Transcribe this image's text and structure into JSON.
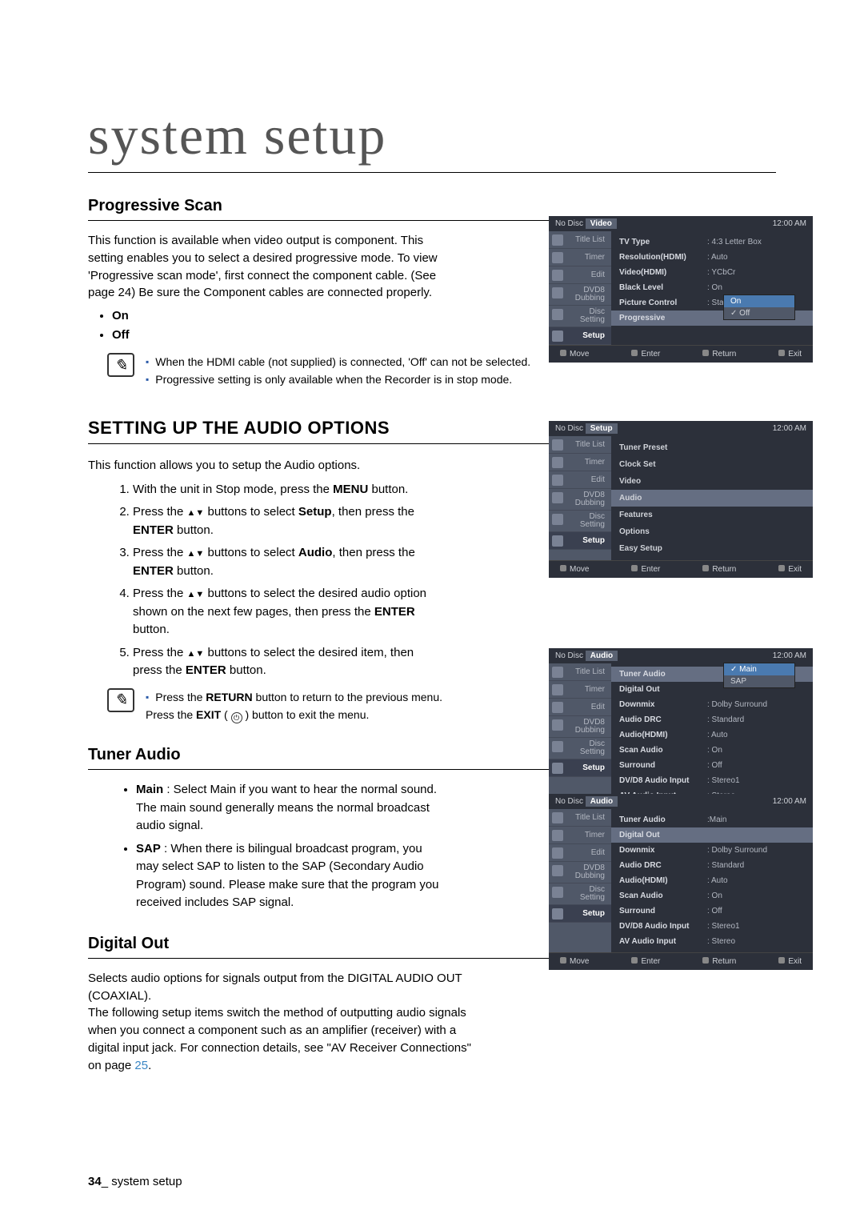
{
  "page_title": "system setup",
  "sec_prog": {
    "h": "Progressive Scan",
    "p": "This function is available when video output is component. This setting enables you to select a desired progressive mode. To view 'Progressive scan mode', first connect the component cable. (See page 24) Be sure the Component cables are connected properly.",
    "b1": "On",
    "b2": "Off",
    "n1": "When the HDMI cable (not supplied) is connected, 'Off' can not be selected.",
    "n2": "Progressive setting is only available when the Recorder is in stop mode."
  },
  "sec_audio": {
    "h": "SETTING UP THE AUDIO OPTIONS",
    "p": "This function allows you to setup the Audio options.",
    "s1a": "With the unit in Stop mode, press the ",
    "s1b": "MENU",
    "s1c": " button.",
    "s2a": "Press the ",
    "s2b": "▲▼",
    "s2c": " buttons to select ",
    "s2d": "Setup",
    "s2e": ", then press the ",
    "s2f": "ENTER",
    "s2g": " button.",
    "s3a": "Press the ",
    "s3b": "▲▼",
    "s3c": " buttons to select ",
    "s3d": "Audio",
    "s3e": ", then press the ",
    "s3f": "ENTER",
    "s3g": " button.",
    "s4a": "Press the ",
    "s4b": "▲▼",
    "s4c": " buttons to select the desired audio option shown on the next few pages, then press the ",
    "s4d": "ENTER",
    "s4e": " button.",
    "s5a": "Press the ",
    "s5b": "▲▼",
    "s5c": " buttons to select the desired item, then press the ",
    "s5d": "ENTER",
    "s5e": " button.",
    "n1a": "Press the ",
    "n1b": "RETURN",
    "n1c": " button to return to the previous menu.",
    "n2a": "Press the ",
    "n2b": "EXIT",
    "n2c": " ( ",
    "n2d": " ) button to exit the menu."
  },
  "sec_tuner": {
    "h": "Tuner Audio",
    "b1t": "Main",
    "b1d": " : Select Main if you want to hear the normal sound. The main sound generally means the normal broadcast audio signal.",
    "b2t": "SAP",
    "b2d": " : When there is bilingual broadcast program, you may select SAP to listen to the SAP (Secondary Audio Program) sound. Please make sure that the program you received includes SAP signal."
  },
  "sec_dout": {
    "h": "Digital Out",
    "p1": "Selects audio options for signals output from the DIGITAL AUDIO OUT (COAXIAL).",
    "p2a": "The following setup items switch the method of outputting audio signals when you connect a component such as an amplifier (receiver) with a digital input jack. For connection details, see \"AV Receiver Connections\" on page ",
    "p2b": "25",
    "p2c": "."
  },
  "footer": {
    "num": "34",
    "sep": "_",
    "txt": " system setup"
  },
  "osd_common": {
    "no_disc": "No Disc",
    "time": "12:00 AM",
    "side": [
      "Title List",
      "Timer",
      "Edit",
      "DVD8\nDubbing",
      "Disc\nSetting",
      "Setup"
    ],
    "bot": [
      "Move",
      "Enter",
      "Return",
      "Exit"
    ]
  },
  "osd1": {
    "crumb": "Video",
    "rows": [
      {
        "k": "TV Type",
        "v": ": 4:3 Letter Box"
      },
      {
        "k": "Resolution(HDMI)",
        "v": ": Auto"
      },
      {
        "k": "Video(HDMI)",
        "v": ": YCbCr"
      },
      {
        "k": "Black Level",
        "v": ": On"
      },
      {
        "k": "Picture Control",
        "v": ": Standard"
      },
      {
        "k": "Progressive",
        "v": ""
      }
    ],
    "drop": [
      "On",
      "Off"
    ]
  },
  "osd2": {
    "crumb": "Setup",
    "rows": [
      "Tuner Preset",
      "Clock Set",
      "Video",
      "Audio",
      "Features",
      "Options",
      "Easy Setup"
    ]
  },
  "osd3": {
    "crumb": "Audio",
    "rows": [
      {
        "k": "Tuner Audio",
        "v": ""
      },
      {
        "k": "Digital Out",
        "v": ""
      },
      {
        "k": "Downmix",
        "v": ": Dolby Surround"
      },
      {
        "k": "Audio DRC",
        "v": ": Standard"
      },
      {
        "k": "Audio(HDMI)",
        "v": ": Auto"
      },
      {
        "k": "Scan Audio",
        "v": ": On"
      },
      {
        "k": "Surround",
        "v": ": Off"
      },
      {
        "k": "DV/D8 Audio Input",
        "v": ": Stereo1"
      },
      {
        "k": "AV Audio Input",
        "v": ": Stereo"
      }
    ],
    "drop": [
      "Main",
      "SAP"
    ]
  },
  "osd4": {
    "crumb": "Audio",
    "rows": [
      {
        "k": "Tuner Audio",
        "v": ":Main"
      },
      {
        "k": "Digital Out",
        "v": ""
      },
      {
        "k": "Downmix",
        "v": ": Dolby Surround"
      },
      {
        "k": "Audio DRC",
        "v": ": Standard"
      },
      {
        "k": "Audio(HDMI)",
        "v": ": Auto"
      },
      {
        "k": "Scan Audio",
        "v": ": On"
      },
      {
        "k": "Surround",
        "v": ": Off"
      },
      {
        "k": "DV/D8 Audio Input",
        "v": ": Stereo1"
      },
      {
        "k": "AV Audio Input",
        "v": ": Stereo"
      }
    ]
  }
}
